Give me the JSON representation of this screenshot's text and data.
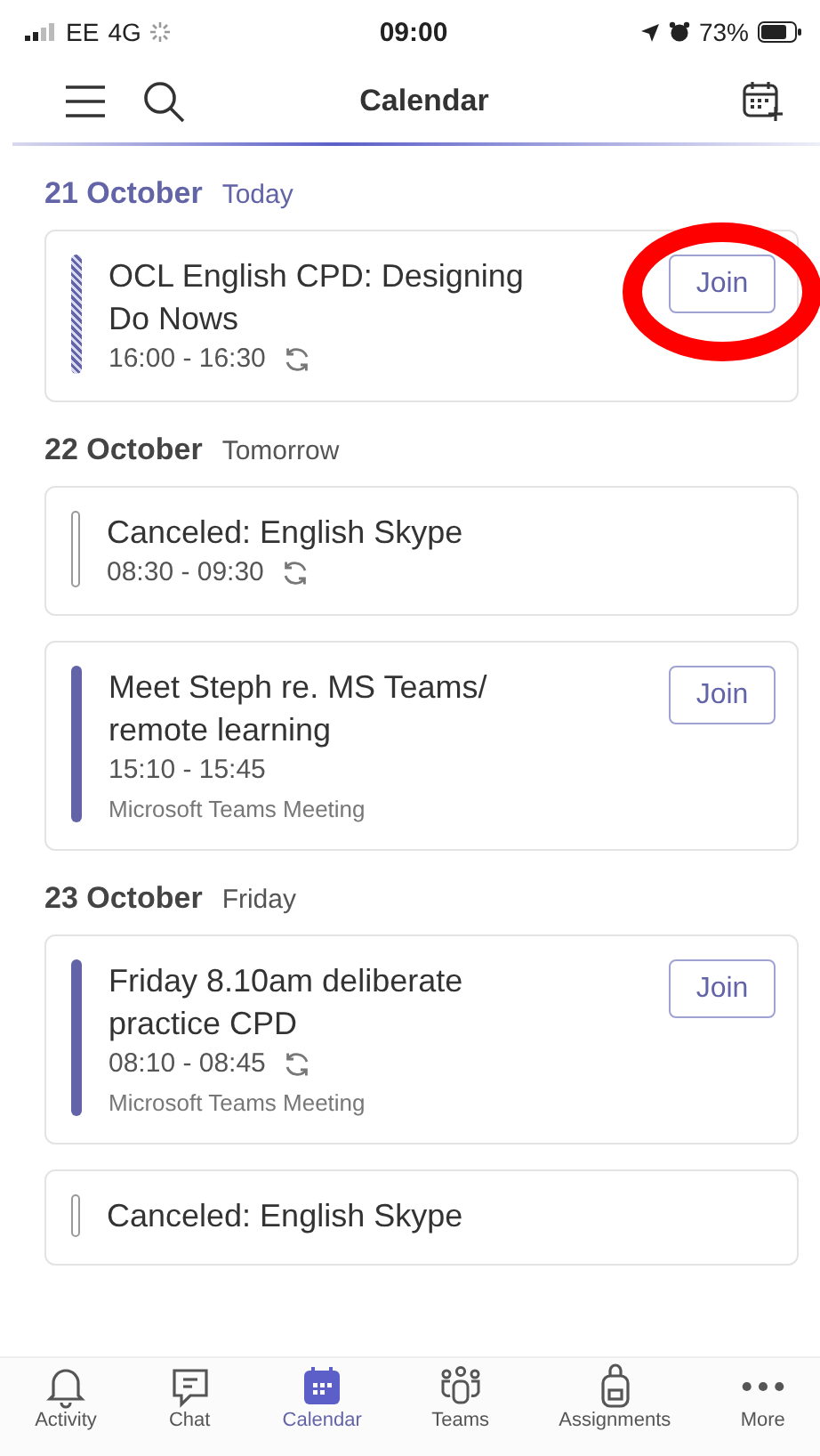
{
  "status_bar": {
    "carrier": "EE",
    "network": "4G",
    "time": "09:00",
    "battery": "73%"
  },
  "header": {
    "title": "Calendar"
  },
  "days": [
    {
      "date": "21 October",
      "relative": "Today",
      "selected": true,
      "events": [
        {
          "title": "OCL English CPD: Designing Do Nows",
          "time": "16:00 - 16:30",
          "recurring": true,
          "kind": "tentative",
          "join": "Join",
          "highlighted": true
        }
      ]
    },
    {
      "date": "22 October",
      "relative": "Tomorrow",
      "selected": false,
      "events": [
        {
          "title": "Canceled: English Skype",
          "time": "08:30 - 09:30",
          "recurring": true,
          "kind": "free"
        },
        {
          "title": "Meet Steph re. MS Teams/ remote learning",
          "time": "15:10 - 15:45",
          "recurring": false,
          "kind": "busy",
          "location": "Microsoft Teams Meeting",
          "join": "Join",
          "highlighted": false
        }
      ]
    },
    {
      "date": "23 October",
      "relative": "Friday",
      "selected": false,
      "events": [
        {
          "title": "Friday 8.10am deliberate practice CPD",
          "time": "08:10 - 08:45",
          "recurring": true,
          "kind": "busy",
          "location": "Microsoft Teams Meeting",
          "join": "Join",
          "highlighted": false
        },
        {
          "title": "Canceled: English Skype",
          "kind": "free"
        }
      ]
    }
  ],
  "tabs": [
    {
      "label": "Activity",
      "selected": false
    },
    {
      "label": "Chat",
      "selected": false
    },
    {
      "label": "Calendar",
      "selected": true
    },
    {
      "label": "Teams",
      "selected": false
    },
    {
      "label": "Assignments",
      "selected": false
    },
    {
      "label": "More",
      "selected": false
    }
  ]
}
